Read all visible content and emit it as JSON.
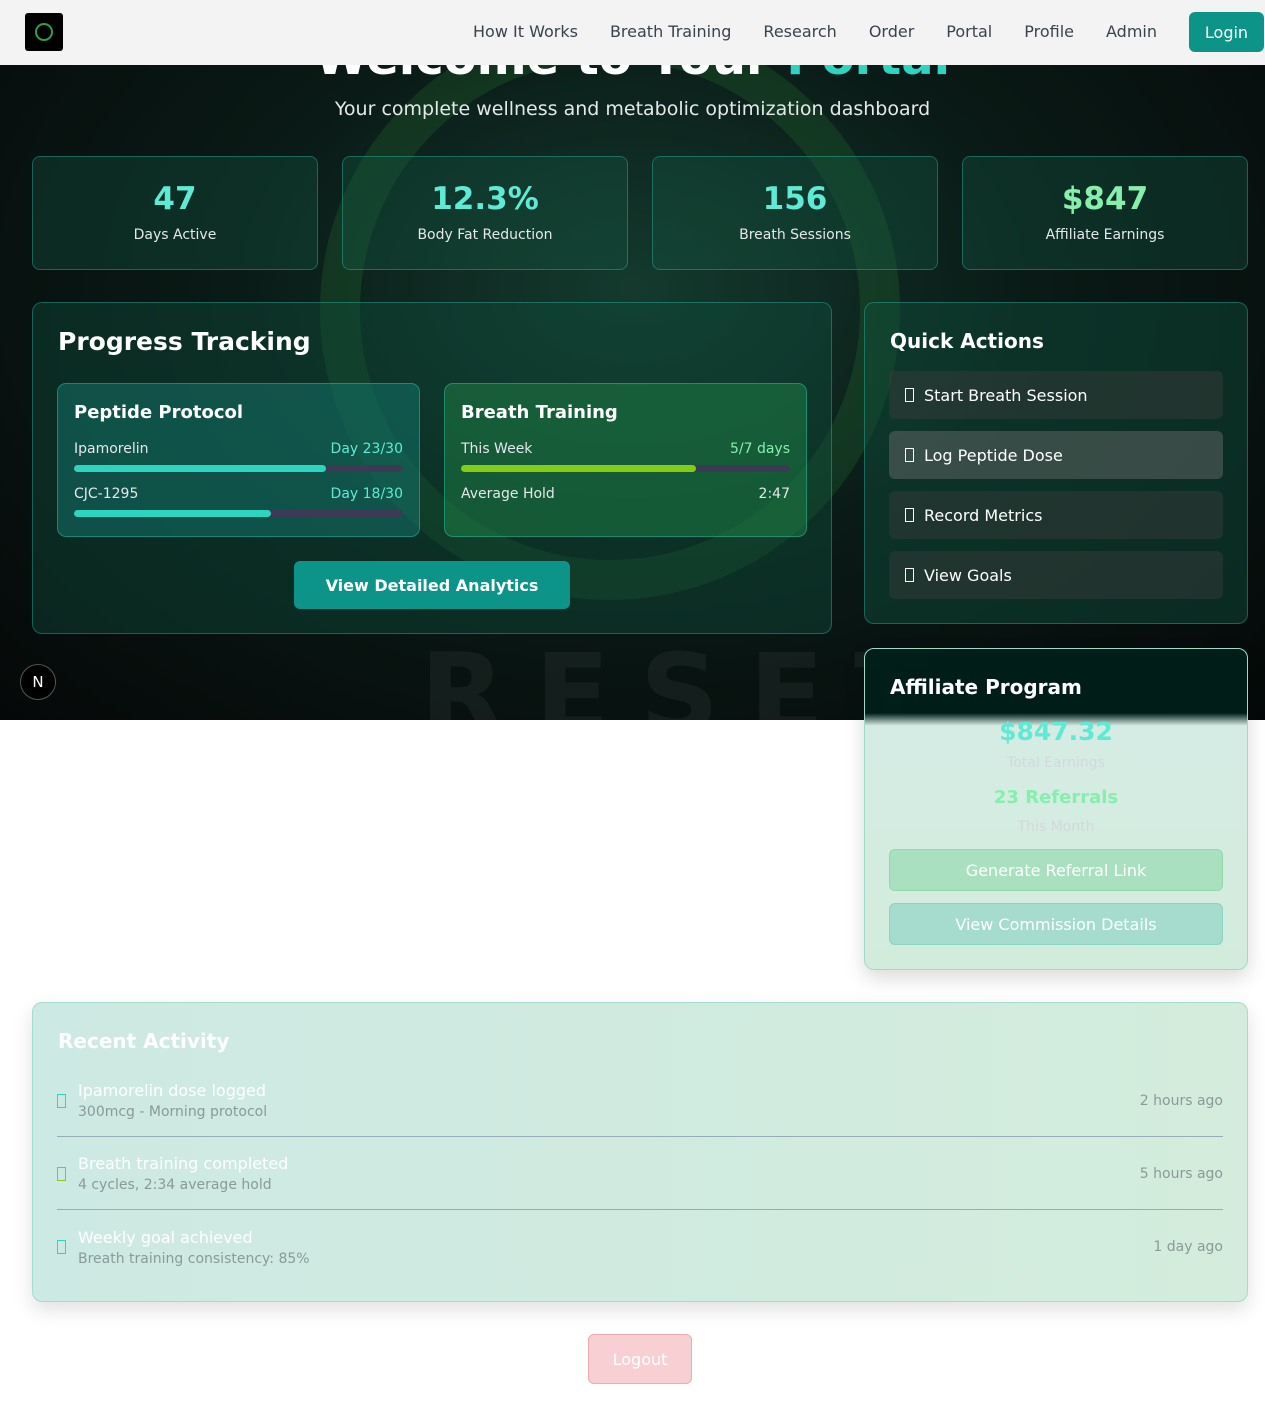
{
  "nav": {
    "links": [
      "How It Works",
      "Breath Training",
      "Research",
      "Order",
      "Portal",
      "Profile",
      "Admin"
    ],
    "login": "Login"
  },
  "hero": {
    "title_a": "Welcome to Your ",
    "title_b": "Portal",
    "subtitle": "Your complete wellness and metabolic optimization dashboard"
  },
  "stats": [
    {
      "value": "47",
      "label": "Days Active"
    },
    {
      "value": "12.3%",
      "label": "Body Fat Reduction"
    },
    {
      "value": "156",
      "label": "Breath Sessions"
    },
    {
      "value": "$847",
      "label": "Affiliate Earnings"
    }
  ],
  "progress": {
    "title": "Progress Tracking",
    "peptide": {
      "title": "Peptide Protocol",
      "items": [
        {
          "name": "Ipamorelin",
          "value": "Day 23/30",
          "pct": 76.7
        },
        {
          "name": "CJC-1295",
          "value": "Day 18/30",
          "pct": 60
        }
      ]
    },
    "breath": {
      "title": "Breath Training",
      "week_label": "This Week",
      "week_value": "5/7 days",
      "week_pct": 71.4,
      "hold_label": "Average Hold",
      "hold_value": "2:47"
    },
    "button": "View Detailed Analytics"
  },
  "quick_actions": {
    "title": "Quick Actions",
    "items": [
      "Start Breath Session",
      "Log Peptide Dose",
      "Record Metrics",
      "View Goals"
    ]
  },
  "affiliate": {
    "title": "Affiliate Program",
    "earnings": "$847.32",
    "earnings_label": "Total Earnings",
    "referrals": "23 Referrals",
    "referrals_label": "This Month",
    "btn_generate": "Generate Referral Link",
    "btn_commission": "View Commission Details"
  },
  "recent": {
    "title": "Recent Activity",
    "items": [
      {
        "title": "Ipamorelin dose logged",
        "detail": "300mcg - Morning protocol",
        "time": "2 hours ago",
        "color": "#2dd4bf"
      },
      {
        "title": "Breath training completed",
        "detail": "4 cycles, 2:34 average hold",
        "time": "5 hours ago",
        "color": "#84cc16"
      },
      {
        "title": "Weekly goal achieved",
        "detail": "Breath training consistency: 85%",
        "time": "1 day ago",
        "color": "#2dd4bf"
      }
    ]
  },
  "logout": "Logout",
  "badge": "N"
}
